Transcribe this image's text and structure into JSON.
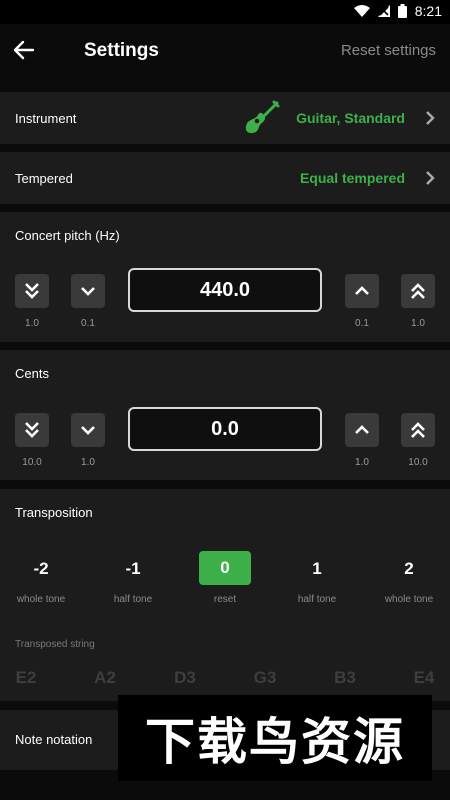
{
  "status_bar": {
    "time": "8:21",
    "icons": [
      "wifi-icon",
      "signal-icon",
      "battery-icon"
    ]
  },
  "appbar": {
    "title": "Settings",
    "reset_label": "Reset settings"
  },
  "instrument": {
    "label": "Instrument",
    "value": "Guitar, Standard",
    "icon": "guitar-icon"
  },
  "tempered": {
    "label": "Tempered",
    "value": "Equal tempered"
  },
  "concert_pitch": {
    "label": "Concert pitch (Hz)",
    "value": "440.0",
    "steps": {
      "big_down": "1.0",
      "small_down": "0.1",
      "small_up": "0.1",
      "big_up": "1.0"
    }
  },
  "cents": {
    "label": "Cents",
    "value": "0.0",
    "steps": {
      "big_down": "10.0",
      "small_down": "1.0",
      "small_up": "1.0",
      "big_up": "10.0"
    }
  },
  "transposition": {
    "label": "Transposition",
    "options": [
      {
        "value": "-2",
        "caption": "whole tone"
      },
      {
        "value": "-1",
        "caption": "half tone"
      },
      {
        "value": "0",
        "caption": "reset"
      },
      {
        "value": "1",
        "caption": "half tone"
      },
      {
        "value": "2",
        "caption": "whole tone"
      }
    ],
    "selected": "0",
    "transposed_label": "Transposed string",
    "strings": [
      "E2",
      "A2",
      "D3",
      "G3",
      "B3",
      "E4"
    ]
  },
  "note_notation": {
    "label": "Note notation"
  },
  "watermark": {
    "text": "下载鸟资源"
  },
  "colors": {
    "accent": "#3db04a",
    "background": "#0b0b0b",
    "row": "#1c1c1c",
    "button": "#3a3a3a"
  }
}
